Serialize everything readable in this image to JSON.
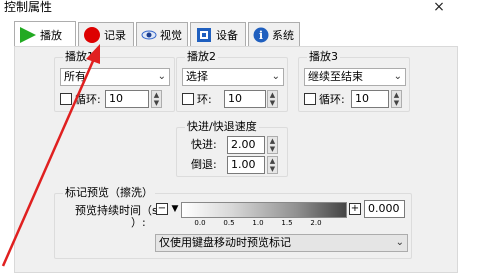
{
  "window": {
    "title": "控制属性",
    "close_glyph": "×"
  },
  "tabs": [
    {
      "label": "播放",
      "icon": "play-icon",
      "icon_color": "#22aa22"
    },
    {
      "label": "记录",
      "icon": "record-icon",
      "icon_color": "#dd0000"
    },
    {
      "label": "视觉",
      "icon": "eye-icon",
      "icon_color": "#3366cc"
    },
    {
      "label": "设备",
      "icon": "device-icon",
      "icon_color": "#1f5fbf"
    },
    {
      "label": "系统",
      "icon": "info-icon",
      "icon_color": "#1f5fbf"
    }
  ],
  "play1": {
    "title": "播放1",
    "combo_value": "所有",
    "loop_label": "循环:",
    "loop_value": "10"
  },
  "play2": {
    "title": "播放2",
    "combo_value": "选择",
    "loop_label": "环:",
    "loop_value": "10"
  },
  "play3": {
    "title": "播放3",
    "combo_value": "继续至结束",
    "loop_label": "循环:",
    "loop_value": "10"
  },
  "speed": {
    "title": "快进/快退速度",
    "forward_label": "快进:",
    "forward_value": "2.00",
    "rewind_label": "倒退:",
    "rewind_value": "1.00"
  },
  "preview": {
    "title": "标记预览（擦洗）",
    "duration_label": "预览持续时间（s",
    "duration_label2": "）:",
    "minus_label": "−",
    "plus_label": "+",
    "value": "0.000",
    "ticks": [
      "0.0",
      "0.5",
      "1.0",
      "1.5",
      "2.0"
    ],
    "slider_level": 0,
    "option_label": "仅使用键盘移动时预览标记"
  },
  "colors": {
    "arrow": "#e02020"
  }
}
